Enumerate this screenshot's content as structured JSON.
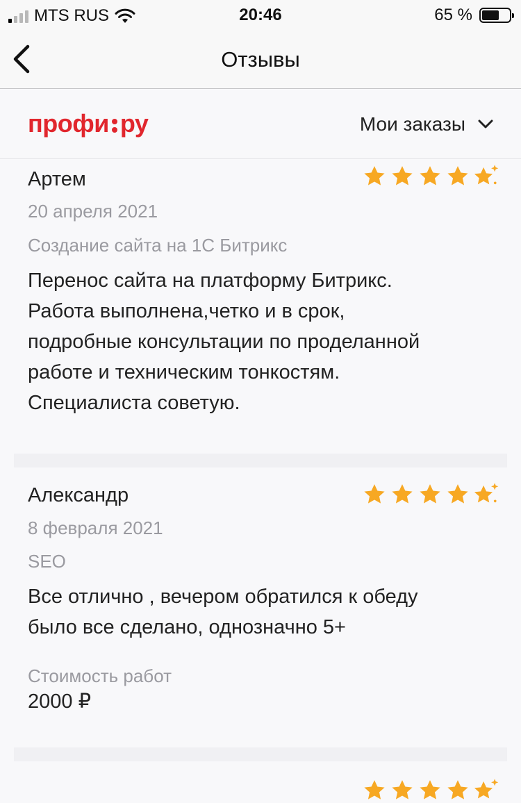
{
  "status_bar": {
    "carrier": "MTS RUS",
    "time": "20:46",
    "battery": "65 %"
  },
  "nav": {
    "title": "Отзывы"
  },
  "brand": {
    "logo_left": "профи",
    "logo_right": "ру",
    "orders_label": "Мои заказы"
  },
  "reviews": [
    {
      "name": "Артем",
      "date": "20 апреля 2021",
      "category": "Создание сайта на 1С Битрикс",
      "text_lines": [
        "Перенос сайта на платформу Битрикс.",
        "Работа выполнена,четко и в срок,",
        "подробные консультации по проделанной",
        "работе и техническим тонкостям.",
        "Специалиста советую."
      ],
      "rating": 5
    },
    {
      "name": "Александр",
      "date": "8 февраля 2021",
      "category": "SEO",
      "text_lines": [
        "Все отлично , вечером обратился к обеду",
        "было все сделано, однозначно 5+"
      ],
      "cost_label": "Стоимость работ",
      "cost_value": "2000 ₽",
      "rating": 5
    }
  ],
  "colors": {
    "star": "#f7a823",
    "brand": "#e1262d"
  },
  "icons": {
    "back": "chevron-left-icon",
    "dropdown": "chevron-down-icon",
    "star": "star-icon",
    "wifi": "wifi-icon"
  }
}
